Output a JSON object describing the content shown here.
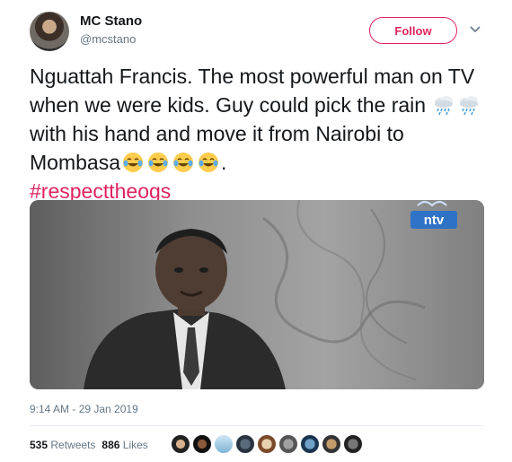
{
  "author": {
    "name": "MC Stano",
    "handle": "@mcstano",
    "avatar_icon": "avatar"
  },
  "follow_button": "Follow",
  "caret_icon": "chevron-down-icon",
  "tweet": {
    "text_part1": "Nguattah Francis. The most powerful man on TV when we were kids. Guy could pick the rain",
    "emoji_rain": "cloud-with-rain-icon",
    "text_part2": " with his hand and move it from Nairobi to Mombasa",
    "emoji_laugh": "face-with-tears-of-joy-icon",
    "text_part3": ".",
    "hashtag": "#respecttheogs"
  },
  "media": {
    "broadcaster_logo": "ntv",
    "description_icon": "video-still"
  },
  "timestamp": "9:14 AM - 29 Jan 2019",
  "stats": {
    "retweets_count": "535",
    "retweets_label": "Retweets",
    "likes_count": "886",
    "likes_label": "Likes"
  },
  "colors": {
    "accent": "#e0245e",
    "text": "#14171a",
    "secondary": "#657786"
  }
}
